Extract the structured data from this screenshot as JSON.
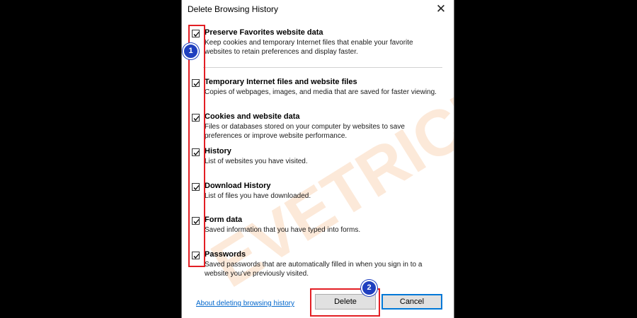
{
  "dialog": {
    "title": "Delete Browsing History",
    "close_icon": "close-icon"
  },
  "items": [
    {
      "title": "Preserve Favorites website data",
      "desc": "Keep cookies and temporary Internet files that enable your favorite websites to retain preferences and display faster.",
      "checked": true
    },
    {
      "title": "Temporary Internet files and website files",
      "desc": "Copies of webpages, images, and media that are saved for faster viewing.",
      "checked": true
    },
    {
      "title": "Cookies and website data",
      "desc": "Files or databases stored on your computer by websites to save preferences or improve website performance.",
      "checked": true
    },
    {
      "title": "History",
      "desc": "List of websites you have visited.",
      "checked": true
    },
    {
      "title": "Download History",
      "desc": "List of files you have downloaded.",
      "checked": true
    },
    {
      "title": "Form data",
      "desc": "Saved information that you have typed into forms.",
      "checked": true
    },
    {
      "title": "Passwords",
      "desc": "Saved passwords that are automatically filled in when you sign in to a website you've previously visited.",
      "checked": true
    }
  ],
  "footer": {
    "link": "About deleting browsing history",
    "delete_label": "Delete",
    "cancel_label": "Cancel"
  },
  "annotations": {
    "badge1": "1",
    "badge2": "2",
    "highlight_color": "#e31e24",
    "badge_color": "#1f3fbf"
  },
  "watermark": {
    "text": "EVETRICKS"
  }
}
